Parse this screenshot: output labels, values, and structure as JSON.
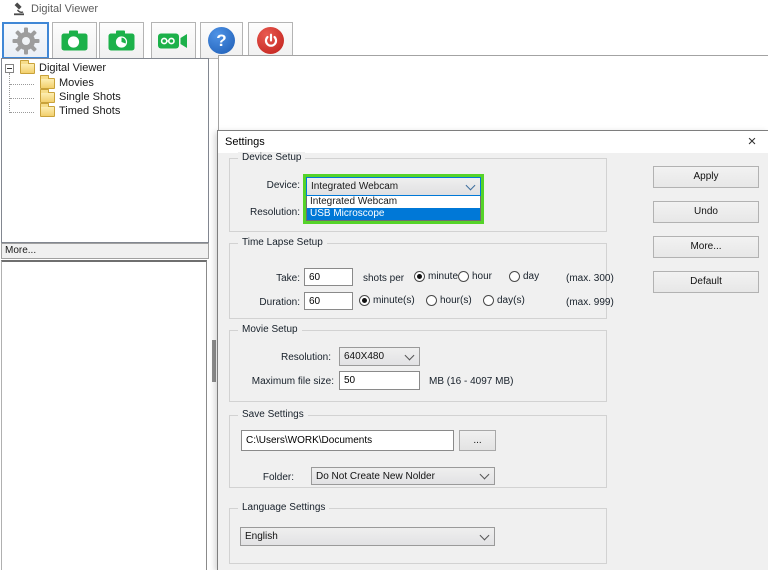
{
  "window": {
    "title": "Digital Viewer"
  },
  "toolbar": {
    "buttons": [
      {
        "name": "settings",
        "icon": "gear-icon"
      },
      {
        "name": "snapshot",
        "icon": "camera-icon"
      },
      {
        "name": "timed-snapshot",
        "icon": "camera-clock-icon"
      },
      {
        "name": "record",
        "icon": "video-camera-icon"
      },
      {
        "name": "help",
        "icon": "help-icon",
        "glyph": "?"
      },
      {
        "name": "power",
        "icon": "power-icon"
      }
    ]
  },
  "sidebar": {
    "tree": {
      "root": "Digital Viewer",
      "children": [
        "Movies",
        "Single Shots",
        "Timed Shots"
      ]
    },
    "more_label": "More..."
  },
  "dialog": {
    "title": "Settings",
    "close_glyph": "×",
    "buttons": [
      "Apply",
      "Undo",
      "More...",
      "Default"
    ],
    "device_setup": {
      "legend": "Device Setup",
      "device_label": "Device:",
      "resolution_label": "Resolution:",
      "device_value": "Integrated Webcam",
      "options": [
        "Integrated Webcam",
        "USB Microscope"
      ],
      "highlighted_option": "USB Microscope"
    },
    "time_lapse": {
      "legend": "Time Lapse Setup",
      "take_label": "Take:",
      "take_value": "60",
      "shots_per": "shots per",
      "take_units": [
        "minute",
        "hour",
        "day"
      ],
      "take_selected": "minute",
      "take_max": "(max. 300)",
      "duration_label": "Duration:",
      "duration_value": "60",
      "duration_units": [
        "minute(s)",
        "hour(s)",
        "day(s)"
      ],
      "duration_selected": "minute(s)",
      "duration_max": "(max. 999)"
    },
    "movie_setup": {
      "legend": "Movie Setup",
      "resolution_label": "Resolution:",
      "resolution_value": "640X480",
      "filesize_label": "Maximum file size:",
      "filesize_value": "50",
      "filesize_hint": "MB (16 - 4097 MB)"
    },
    "save_settings": {
      "legend": "Save Settings",
      "path_value": "C:\\Users\\WORK\\Documents",
      "browse_label": "...",
      "folder_label": "Folder:",
      "folder_value": "Do Not Create New Nolder"
    },
    "language_settings": {
      "legend": "Language Settings",
      "language_value": "English"
    }
  },
  "colors": {
    "highlight_green": "#55d329",
    "selection_blue": "#0078d7",
    "toolbar_green": "#1cb14a",
    "help_blue": "#2e76d2",
    "power_red": "#d2302c"
  }
}
